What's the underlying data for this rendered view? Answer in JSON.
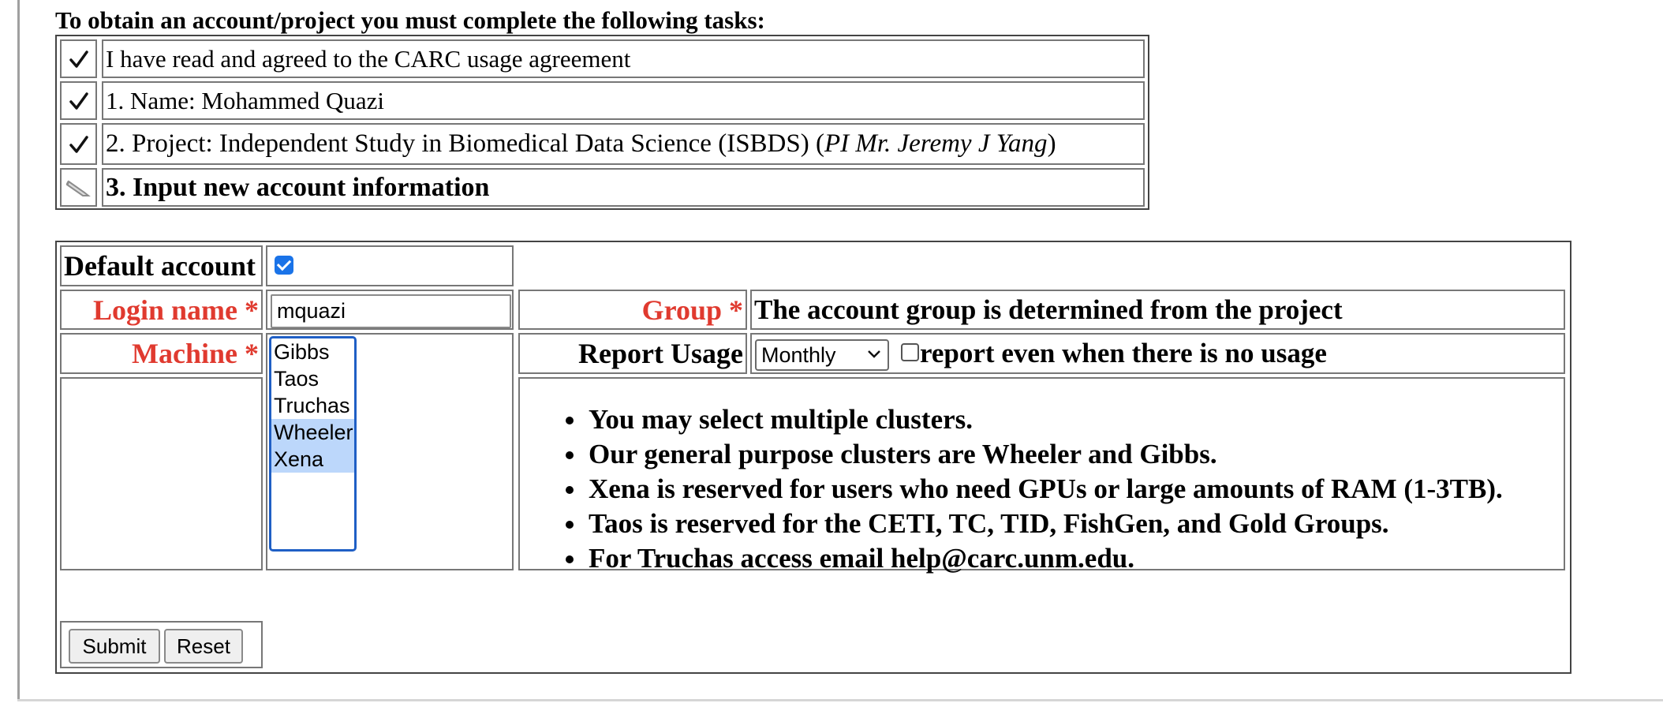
{
  "intro": "To obtain an account/project you must complete the following tasks:",
  "tasks": [
    {
      "icon": "checkmark",
      "text": "I have read and agreed to the CARC usage agreement"
    },
    {
      "icon": "checkmark",
      "text": "1. Name: Mohammed Quazi"
    },
    {
      "icon": "checkmark",
      "text_prefix": "2. Project: Independent Study in Biomedical Data Science (ISBDS) (",
      "pi": "PI Mr. Jeremy J Yang",
      "text_suffix": ")"
    },
    {
      "icon": "pencil",
      "text": "3. Input new account information"
    }
  ],
  "form": {
    "default_account_label": "Default account",
    "default_account_checked": true,
    "login_label": "Login name",
    "required_mark": "*",
    "login_value": "mquazi",
    "group_label": "Group",
    "group_text": "The account group is determined from the project",
    "machine_label": "Machine",
    "machines": [
      {
        "name": "Gibbs",
        "selected": false
      },
      {
        "name": "Taos",
        "selected": false
      },
      {
        "name": "Truchas",
        "selected": false
      },
      {
        "name": "Wheeler",
        "selected": true
      },
      {
        "name": "Xena",
        "selected": true
      }
    ],
    "report_usage_label": "Report Usage",
    "report_usage_value": "Monthly",
    "report_no_usage_checked": false,
    "report_no_usage_label": "report even when there is no usage",
    "notes": [
      "You may select multiple clusters.",
      "Our general purpose clusters are Wheeler and Gibbs.",
      "Xena is reserved for users who need GPUs or large amounts of RAM (1-3TB).",
      "Taos is reserved for the CETI, TC, TID, FishGen, and Gold Groups.",
      "For Truchas access email help@carc.unm.edu."
    ],
    "submit_label": "Submit",
    "reset_label": "Reset"
  },
  "colors": {
    "required": "#e03a2f",
    "checkbox": "#1a73e8",
    "listbox_focus": "#1f5fc5",
    "selection": "#bcd7fb"
  }
}
